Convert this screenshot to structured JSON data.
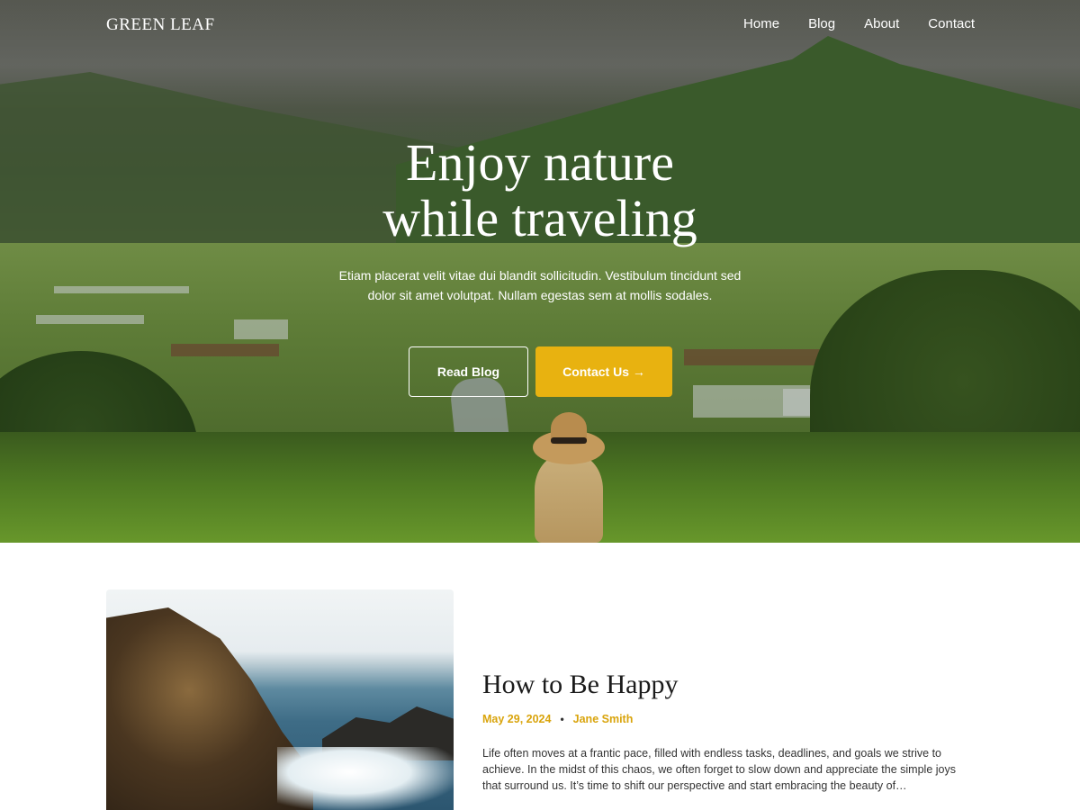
{
  "site": {
    "title": "GREEN LEAF"
  },
  "nav": {
    "items": [
      {
        "label": "Home"
      },
      {
        "label": "Blog"
      },
      {
        "label": "About"
      },
      {
        "label": "Contact"
      }
    ]
  },
  "hero": {
    "title_line1": "Enjoy nature",
    "title_line2": "while traveling",
    "subtitle_line1": "Etiam placerat velit vitae dui blandit sollicitudin. Vestibulum tincidunt sed",
    "subtitle_line2": "dolor sit amet volutpat. Nullam egestas sem at mollis sodales.",
    "primary_button": "Read Blog",
    "secondary_button": "Contact Us →"
  },
  "post": {
    "title": "How to Be Happy",
    "date": "May 29, 2024",
    "separator": "•",
    "author": "Jane Smith",
    "excerpt": "Life often moves at a frantic pace, filled with endless tasks, deadlines, and goals we strive to achieve. In the midst of this chaos, we often forget to slow down and appreciate the simple joys that surround us. It’s time to shift our perspective and start embracing the beauty of…"
  },
  "colors": {
    "accent": "#e8b210",
    "text": "#1b1b1b",
    "white": "#ffffff"
  }
}
